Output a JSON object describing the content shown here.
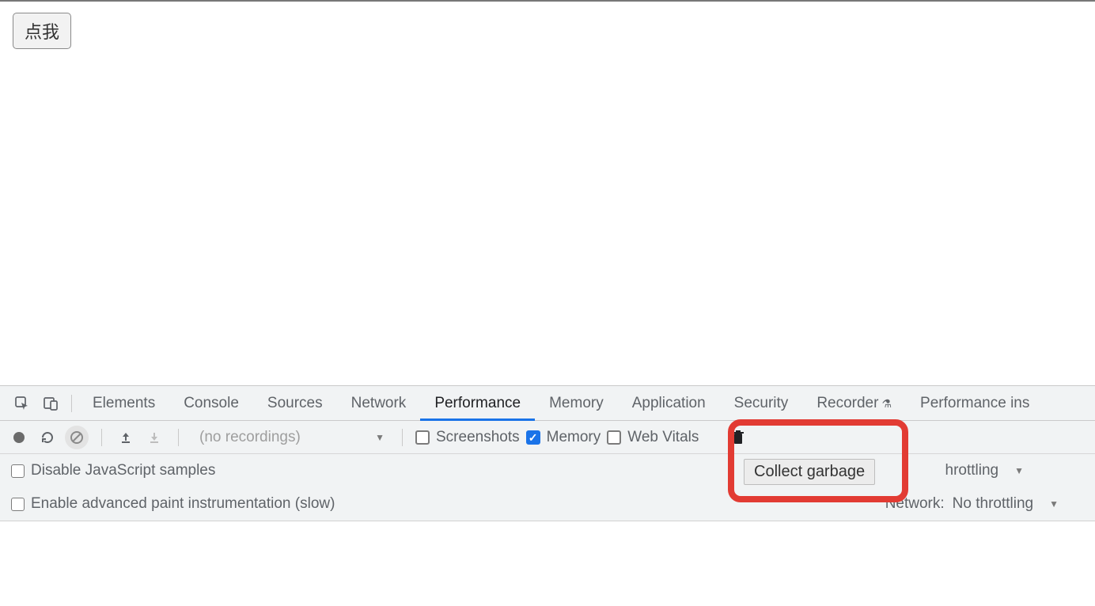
{
  "page": {
    "button_label": "点我"
  },
  "devtools": {
    "tabs": {
      "elements": "Elements",
      "console": "Console",
      "sources": "Sources",
      "network": "Network",
      "performance": "Performance",
      "memory": "Memory",
      "application": "Application",
      "security": "Security",
      "recorder": "Recorder",
      "performance_insights": "Performance ins"
    },
    "active_tab": "performance",
    "toolbar": {
      "recordings_placeholder": "(no recordings)",
      "checkboxes": {
        "screenshots": {
          "label": "Screenshots",
          "checked": false
        },
        "memory": {
          "label": "Memory",
          "checked": true
        },
        "web_vitals": {
          "label": "Web Vitals",
          "checked": false
        }
      }
    },
    "options": {
      "disable_js_samples": {
        "label": "Disable JavaScript samples",
        "checked": false
      },
      "enable_paint": {
        "label": "Enable advanced paint instrumentation (slow)",
        "checked": false
      },
      "cpu": {
        "label_suffix": "hrottling",
        "value": ""
      },
      "network": {
        "label": "Network:",
        "value": "No throttling"
      }
    },
    "tooltip": "Collect garbage"
  },
  "colors": {
    "accent": "#1a73e8",
    "highlight": "#e23b33"
  }
}
